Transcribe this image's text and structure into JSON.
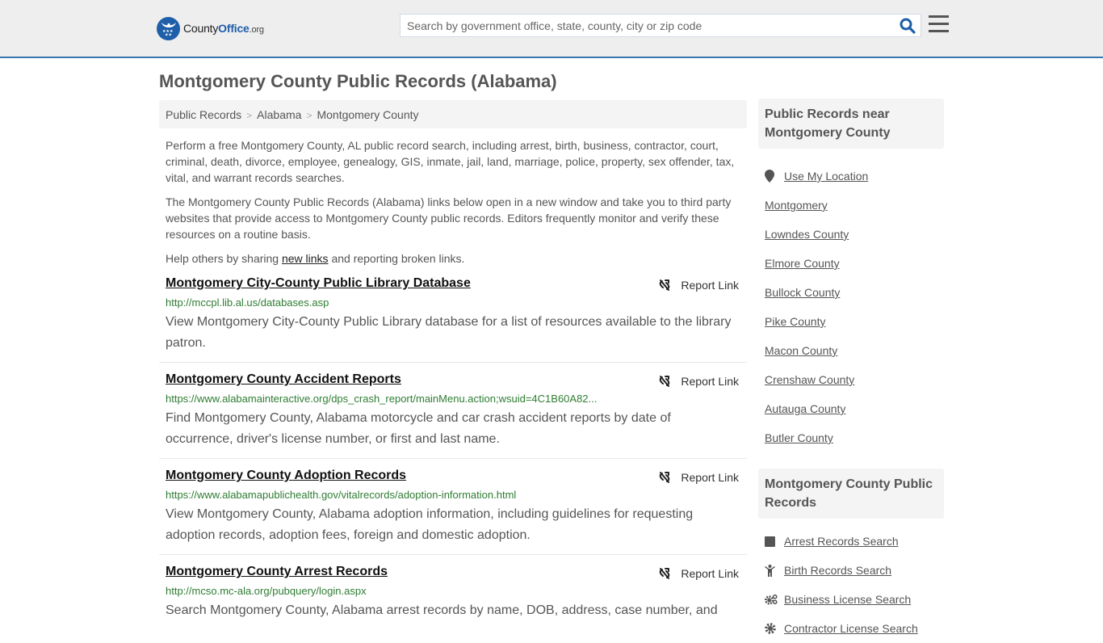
{
  "header": {
    "logo": {
      "prefix": "County",
      "brand": "Office",
      "suffix": ".org"
    },
    "search": {
      "placeholder": "Search by government office, state, county, city or zip code",
      "value": ""
    },
    "search_icon": "search-icon",
    "menu_icon": "hamburger-menu-icon"
  },
  "page": {
    "title": "Montgomery County Public Records (Alabama)"
  },
  "breadcrumb": [
    {
      "label": "Public Records"
    },
    {
      "label": "Alabama"
    },
    {
      "label": "Montgomery County"
    }
  ],
  "breadcrumb_separator": ">",
  "intro": {
    "p1": "Perform a free Montgomery County, AL public record search, including arrest, birth, business, contractor, court, criminal, death, divorce, employee, genealogy, GIS, inmate, jail, land, marriage, police, property, sex offender, tax, vital, and warrant records searches.",
    "p2": "The Montgomery County Public Records (Alabama) links below open in a new window and take you to third party websites that provide access to Montgomery County public records. Editors frequently monitor and verify these resources on a routine basis.",
    "p3_before": "Help others by sharing ",
    "p3_link": "new links",
    "p3_after": " and reporting broken links."
  },
  "report_link_label": "Report Link",
  "records": [
    {
      "title": "Montgomery City-County Public Library Database",
      "url": "http://mccpl.lib.al.us/databases.asp",
      "description": "View Montgomery City-County Public Library database for a list of resources available to the library patron."
    },
    {
      "title": "Montgomery County Accident Reports",
      "url": "https://www.alabamainteractive.org/dps_crash_report/mainMenu.action;wsuid=4C1B60A82...",
      "description": "Find Montgomery County, Alabama motorcycle and car crash accident reports by date of occurrence, driver's license number, or first and last name."
    },
    {
      "title": "Montgomery County Adoption Records",
      "url": "https://www.alabamapublichealth.gov/vitalrecords/adoption-information.html",
      "description": "View Montgomery County, Alabama adoption information, including guidelines for requesting adoption records, adoption fees, foreign and domestic adoption."
    },
    {
      "title": "Montgomery County Arrest Records",
      "url": "http://mcso.mc-ala.org/pubquery/login.aspx",
      "description": "Search Montgomery County, Alabama arrest records by name, DOB, address, case number, and"
    }
  ],
  "sidebar": {
    "nearby": {
      "heading": "Public Records near Montgomery County",
      "use_location": "Use My Location",
      "items": [
        "Montgomery",
        "Lowndes County",
        "Elmore County",
        "Bullock County",
        "Pike County",
        "Macon County",
        "Crenshaw County",
        "Autauga County",
        "Butler County"
      ]
    },
    "county_records": {
      "heading": "Montgomery County Public Records",
      "items": [
        {
          "label": "Arrest Records Search",
          "icon": "square-icon"
        },
        {
          "label": "Birth Records Search",
          "icon": "child-icon"
        },
        {
          "label": "Business License Search",
          "icon": "cogs-icon"
        },
        {
          "label": "Contractor License Search",
          "icon": "gear-icon"
        }
      ]
    }
  },
  "colors": {
    "brand_blue": "#1f5ea8",
    "header_bg": "#eeeeee",
    "header_border": "#3a76b0",
    "url_green": "#2e7d32",
    "text_gray": "#555555"
  }
}
